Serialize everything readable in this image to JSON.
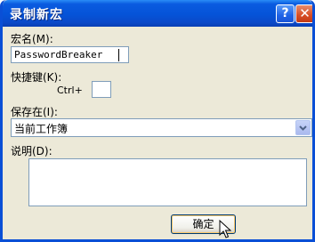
{
  "dialog": {
    "title": "录制新宏",
    "help_glyph": "?",
    "close_glyph": "✕"
  },
  "macro_name": {
    "label": "宏名(M):",
    "value": "PasswordBreaker"
  },
  "shortcut": {
    "label": "快捷键(K):",
    "prefix": "Ctrl+",
    "value": ""
  },
  "store_in": {
    "label": "保存在(I):",
    "selected": "当前工作簿"
  },
  "description": {
    "label": "说明(D):",
    "value": ""
  },
  "buttons": {
    "ok": "确定"
  },
  "icons": {
    "help": "help-icon",
    "close": "close-icon",
    "dropdown": "chevron-down-icon",
    "cursor": "mouse-pointer-icon"
  }
}
